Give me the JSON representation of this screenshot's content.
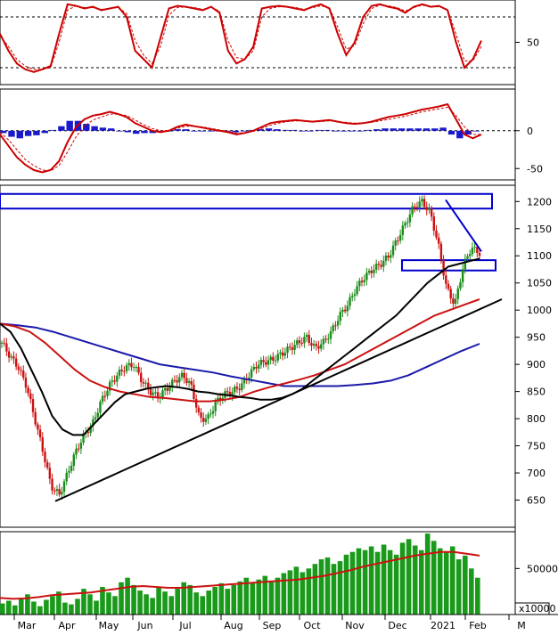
{
  "chart_data": [
    {
      "type": "line",
      "panel": "stochastic",
      "ylim": [
        0,
        100
      ],
      "y_ticks": [
        50
      ],
      "reference_lines": [
        80,
        20
      ],
      "x_months": [
        "Mar",
        "Apr",
        "May",
        "Jun",
        "Jul",
        "Aug",
        "Sep",
        "Oct",
        "Nov",
        "Dec",
        "2021",
        "Feb",
        "M"
      ],
      "series": [
        {
          "color": "#cc0000",
          "style": "solid",
          "values": [
            60,
            40,
            25,
            18,
            15,
            18,
            22,
            60,
            95,
            93,
            90,
            92,
            88,
            90,
            92,
            80,
            40,
            30,
            20,
            55,
            90,
            93,
            92,
            90,
            88,
            92,
            85,
            40,
            25,
            30,
            45,
            90,
            92,
            93,
            92,
            90,
            88,
            92,
            95,
            90,
            60,
            35,
            50,
            80,
            93,
            95,
            92,
            90,
            85,
            92,
            95,
            92,
            93,
            88,
            50,
            20,
            30,
            52
          ]
        },
        {
          "color": "#cc0000",
          "style": "dashed",
          "values": [
            58,
            45,
            30,
            22,
            18,
            18,
            20,
            50,
            88,
            93,
            91,
            91,
            89,
            90,
            91,
            84,
            52,
            35,
            25,
            45,
            82,
            91,
            92,
            91,
            89,
            91,
            87,
            52,
            32,
            30,
            40,
            80,
            90,
            92,
            92,
            91,
            89,
            91,
            93,
            91,
            68,
            42,
            46,
            72,
            90,
            94,
            93,
            91,
            87,
            91,
            94,
            92,
            92,
            89,
            60,
            28,
            28,
            45
          ]
        }
      ]
    },
    {
      "type": "line",
      "panel": "macd",
      "ylim": [
        -65,
        55
      ],
      "y_ticks": [
        0,
        -50
      ],
      "reference_lines": [
        0
      ],
      "series": [
        {
          "color": "#cc0000",
          "style": "solid",
          "values": [
            -5,
            -20,
            -35,
            -45,
            -52,
            -55,
            -52,
            -40,
            -15,
            5,
            15,
            20,
            22,
            25,
            22,
            18,
            10,
            5,
            0,
            -2,
            0,
            5,
            8,
            6,
            4,
            2,
            0,
            -2,
            -5,
            -3,
            0,
            5,
            10,
            12,
            13,
            14,
            13,
            12,
            13,
            14,
            12,
            10,
            9,
            10,
            12,
            15,
            18,
            20,
            22,
            25,
            28,
            30,
            32,
            35,
            15,
            -5,
            -10,
            -5
          ]
        },
        {
          "color": "#cc0000",
          "style": "dashed",
          "values": [
            -2,
            -12,
            -25,
            -38,
            -46,
            -52,
            -53,
            -46,
            -28,
            -8,
            6,
            14,
            18,
            22,
            22,
            20,
            14,
            8,
            3,
            0,
            0,
            3,
            6,
            6,
            5,
            3,
            1,
            -1,
            -3,
            -3,
            -1,
            3,
            7,
            10,
            12,
            13,
            13,
            12,
            12,
            13,
            12,
            11,
            10,
            10,
            11,
            13,
            15,
            17,
            19,
            22,
            25,
            27,
            29,
            31,
            20,
            5,
            -5,
            -5
          ]
        },
        {
          "color": "#1a1acc",
          "style": "histogram",
          "values": [
            -3,
            -8,
            -10,
            -7,
            -6,
            -3,
            1,
            6,
            13,
            13,
            9,
            6,
            4,
            3,
            0,
            -2,
            -4,
            -3,
            -3,
            -2,
            0,
            2,
            2,
            0,
            -1,
            -1,
            -1,
            -1,
            -2,
            0,
            1,
            2,
            3,
            2,
            1,
            1,
            0,
            0,
            1,
            1,
            0,
            -1,
            -1,
            0,
            1,
            2,
            3,
            3,
            3,
            3,
            3,
            3,
            3,
            4,
            -5,
            -10,
            -5,
            0
          ]
        }
      ]
    },
    {
      "type": "line",
      "panel": "price",
      "ylim": [
        600,
        1230
      ],
      "y_ticks": [
        650,
        700,
        750,
        800,
        850,
        900,
        950,
        1000,
        1050,
        1100,
        1150,
        1200
      ],
      "price_close": [
        940,
        915,
        895,
        860,
        800,
        740,
        675,
        660,
        700,
        740,
        770,
        790,
        830,
        860,
        880,
        895,
        900,
        870,
        850,
        840,
        855,
        870,
        880,
        860,
        800,
        800,
        830,
        845,
        850,
        860,
        880,
        900,
        905,
        910,
        920,
        930,
        940,
        950,
        930,
        940,
        960,
        990,
        1010,
        1040,
        1060,
        1075,
        1085,
        1100,
        1130,
        1160,
        1190,
        1200,
        1180,
        1120,
        1040,
        1010,
        1080,
        1115,
        1105
      ],
      "ma_short_black": [
        975,
        960,
        930,
        890,
        850,
        805,
        780,
        770,
        770,
        790,
        810,
        830,
        845,
        850,
        855,
        858,
        860,
        858,
        855,
        850,
        848,
        845,
        843,
        840,
        838,
        835,
        835,
        838,
        845,
        855,
        870,
        885,
        900,
        915,
        930,
        945,
        960,
        975,
        990,
        1010,
        1030,
        1050,
        1065,
        1080,
        1085,
        1090,
        1095
      ],
      "ma_mid_red": [
        975,
        970,
        960,
        940,
        915,
        890,
        870,
        858,
        850,
        845,
        840,
        838,
        835,
        832,
        832,
        835,
        840,
        850,
        858,
        865,
        872,
        880,
        890,
        900,
        915,
        930,
        945,
        960,
        975,
        990,
        1000,
        1010,
        1020
      ],
      "ma_long_blue": [
        975,
        972,
        968,
        960,
        950,
        940,
        930,
        920,
        910,
        900,
        895,
        890,
        885,
        878,
        872,
        866,
        860,
        860,
        860,
        860,
        862,
        865,
        870,
        880,
        895,
        910,
        925,
        938
      ],
      "trendline": {
        "from": [
          "Mar",
          648
        ],
        "to": [
          "Feb",
          1020
        ]
      },
      "falling_line": {
        "from": [
          1203
        ],
        "to": [
          1108
        ]
      },
      "resistance_box": [
        1187,
        1214
      ],
      "support_box": [
        1073,
        1092
      ]
    },
    {
      "type": "bar",
      "panel": "volume",
      "ylim": [
        0,
        90000
      ],
      "y_ticks": [
        50000
      ],
      "y_unit": "x10000",
      "values": [
        12000,
        15000,
        10000,
        18000,
        22000,
        14000,
        9000,
        16000,
        20000,
        25000,
        13000,
        11000,
        17000,
        28000,
        22000,
        15000,
        30000,
        24000,
        20000,
        35000,
        40000,
        32000,
        26000,
        22000,
        18000,
        30000,
        25000,
        20000,
        28000,
        35000,
        32000,
        24000,
        20000,
        26000,
        30000,
        34000,
        28000,
        32000,
        36000,
        40000,
        34000,
        38000,
        42000,
        36000,
        40000,
        45000,
        48000,
        52000,
        46000,
        50000,
        55000,
        60000,
        62000,
        55000,
        58000,
        65000,
        68000,
        72000,
        70000,
        74000,
        68000,
        76000,
        70000,
        65000,
        78000,
        82000,
        75000,
        70000,
        88000,
        80000,
        72000,
        68000,
        74000,
        60000,
        64000,
        50000,
        40000
      ],
      "ma_red": [
        18000,
        17000,
        17500,
        19000,
        21000,
        22000,
        23000,
        24000,
        26000,
        28000,
        30000,
        31000,
        30000,
        29000,
        29000,
        30000,
        31000,
        32000,
        33000,
        34000,
        35000,
        36000,
        37000,
        38000,
        40000,
        42000,
        45000,
        48000,
        52000,
        55000,
        58000,
        61000,
        64000,
        66000,
        68000,
        68000,
        66000,
        64000
      ]
    }
  ]
}
